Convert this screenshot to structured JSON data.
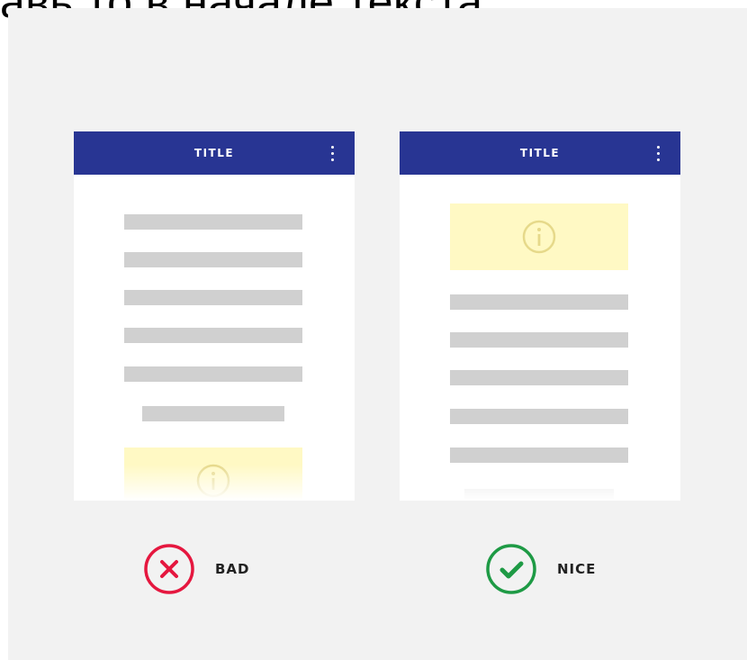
{
  "top_text": "авь то в начале текста",
  "left_mockup": {
    "appbar_title": "TITLE",
    "info_icon": "info-circle-icon",
    "menu_icon": "more-vert-icon",
    "verdict": {
      "label": "BAD",
      "icon": "cross-circle-icon",
      "color": "#e5173f"
    }
  },
  "right_mockup": {
    "appbar_title": "TITLE",
    "info_icon": "info-circle-icon",
    "menu_icon": "more-vert-icon",
    "verdict": {
      "label": "NICE",
      "icon": "check-circle-icon",
      "color": "#1e9a45"
    }
  },
  "colors": {
    "appbar": "#283593",
    "background": "#f2f2f2",
    "placeholder_line": "#d0d0d0",
    "info_box": "#fff9c4",
    "info_icon": "#e6d98a"
  }
}
